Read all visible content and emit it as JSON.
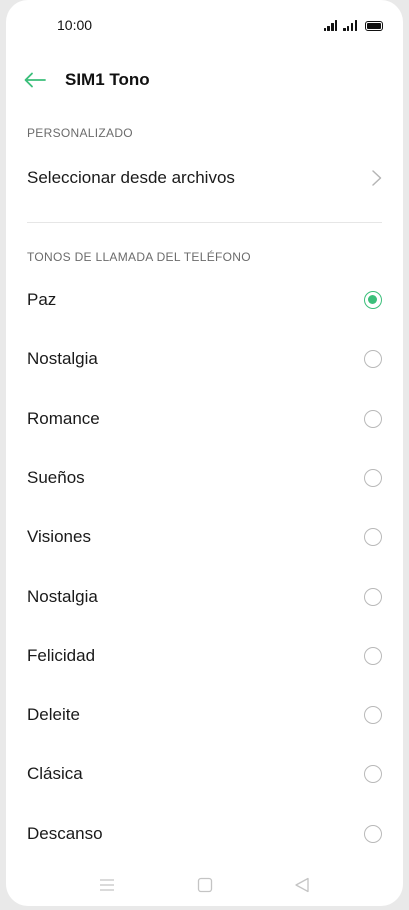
{
  "status": {
    "time": "10:00"
  },
  "header": {
    "title": "SIM1 Tono"
  },
  "custom_section": {
    "label": "PERSONALIZADO",
    "select_files": "Seleccionar desde archivos"
  },
  "ringtones_section": {
    "label": "TONOS DE LLAMADA DEL TELÉFONO",
    "selected_index": 0,
    "items": [
      {
        "label": "Paz",
        "selected": true
      },
      {
        "label": "Nostalgia",
        "selected": false
      },
      {
        "label": "Romance",
        "selected": false
      },
      {
        "label": "Sueños",
        "selected": false
      },
      {
        "label": "Visiones",
        "selected": false
      },
      {
        "label": "Nostalgia",
        "selected": false
      },
      {
        "label": "Felicidad",
        "selected": false
      },
      {
        "label": "Deleite",
        "selected": false
      },
      {
        "label": "Clásica",
        "selected": false
      },
      {
        "label": "Descanso",
        "selected": false
      }
    ]
  },
  "colors": {
    "accent": "#3bbf7a"
  },
  "icons": {
    "back": "arrow-left-icon",
    "chevron": "chevron-right-icon",
    "nav_menu": "menu-icon",
    "nav_home": "square-home-icon",
    "nav_back": "triangle-back-icon"
  }
}
